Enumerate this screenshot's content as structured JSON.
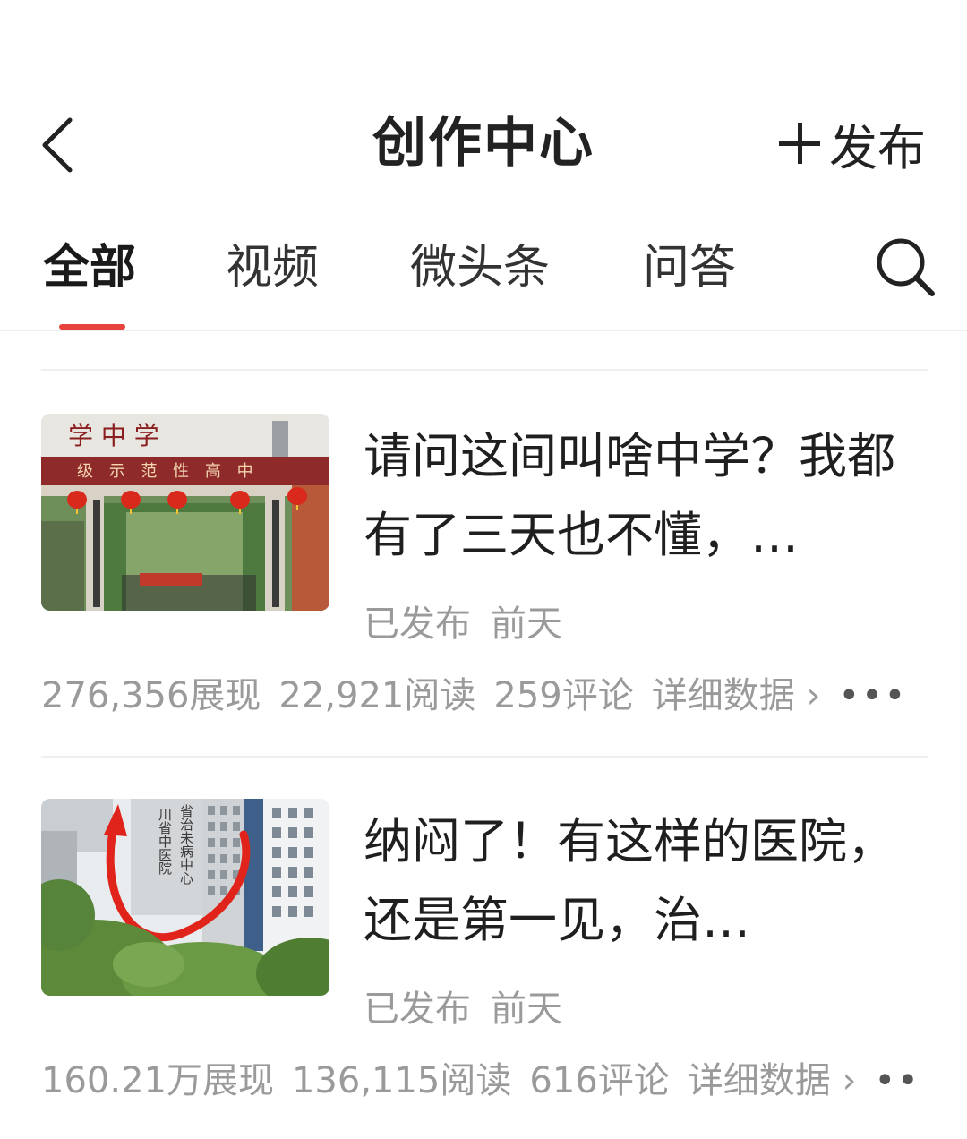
{
  "header": {
    "title": "创作中心",
    "publish_label": "发布",
    "icons": {
      "back": "chevron-left-icon",
      "publish": "plus-icon",
      "search": "search-icon"
    }
  },
  "tabs": [
    {
      "label": "全部",
      "active": true
    },
    {
      "label": "视频",
      "active": false
    },
    {
      "label": "微头条",
      "active": false
    },
    {
      "label": "问答",
      "active": false
    }
  ],
  "accent_color": "#e8433d",
  "cards": [
    {
      "title": "请问这间叫啥中学？我都有了三天也不懂，…",
      "status": "已发布",
      "time": "前天",
      "impressions": "276,356展现",
      "reads": "22,921阅读",
      "comments": "259评论",
      "detail_label": "详细数据 ›",
      "more": "•••",
      "thumb_text": {
        "banner": "级 示 范 性 高 中",
        "top": "学 中 学"
      }
    },
    {
      "title": "纳闷了！有这样的医院，还是第一见，治…",
      "status": "已发布",
      "time": "前天",
      "impressions": "160.21万展现",
      "reads": "136,115阅读",
      "comments": "616评论",
      "detail_label": "详细数据 ›",
      "more": "••",
      "thumb_text": {
        "col1": "川省中医院",
        "col2": "省治未病中心"
      }
    }
  ]
}
